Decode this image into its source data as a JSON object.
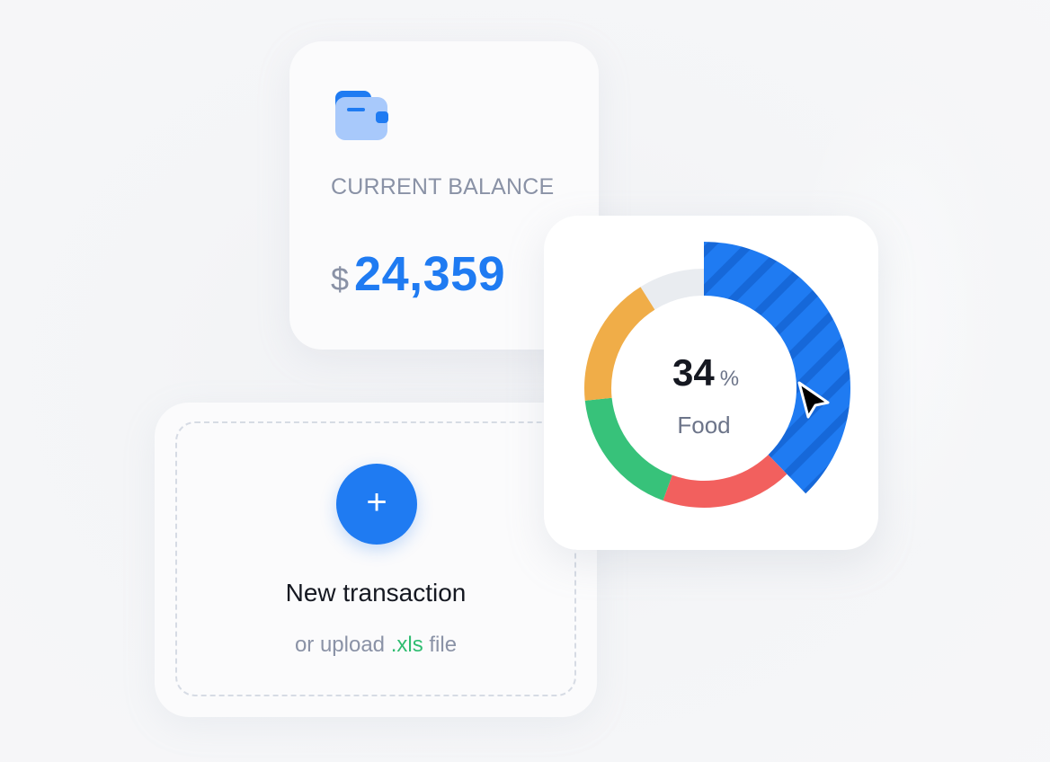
{
  "balance": {
    "label": "CURRENT BALANCE",
    "currency": "$",
    "amount": "24,359",
    "icon": "wallet-icon"
  },
  "transaction": {
    "add_icon": "+",
    "title": "New transaction",
    "subtitle_prefix": "or upload ",
    "subtitle_ext": ".xls",
    "subtitle_suffix": " file"
  },
  "donut": {
    "value": "34",
    "unit": "%",
    "label": "Food"
  },
  "colors": {
    "accent": "#1f7bf2",
    "orange": "#f0ad48",
    "green": "#37c27a",
    "red": "#f2605e",
    "track": "#e9ecf0"
  },
  "chart_data": {
    "type": "pie",
    "variant": "donut",
    "labels": [
      "",
      "",
      "",
      "",
      ""
    ],
    "values": [
      34,
      16,
      16,
      16,
      8
    ],
    "highlighted_index": 0,
    "colors": [
      "#1f7bf2",
      "#f2605e",
      "#37c27a",
      "#f0ad48",
      "#e9ecf0"
    ]
  }
}
